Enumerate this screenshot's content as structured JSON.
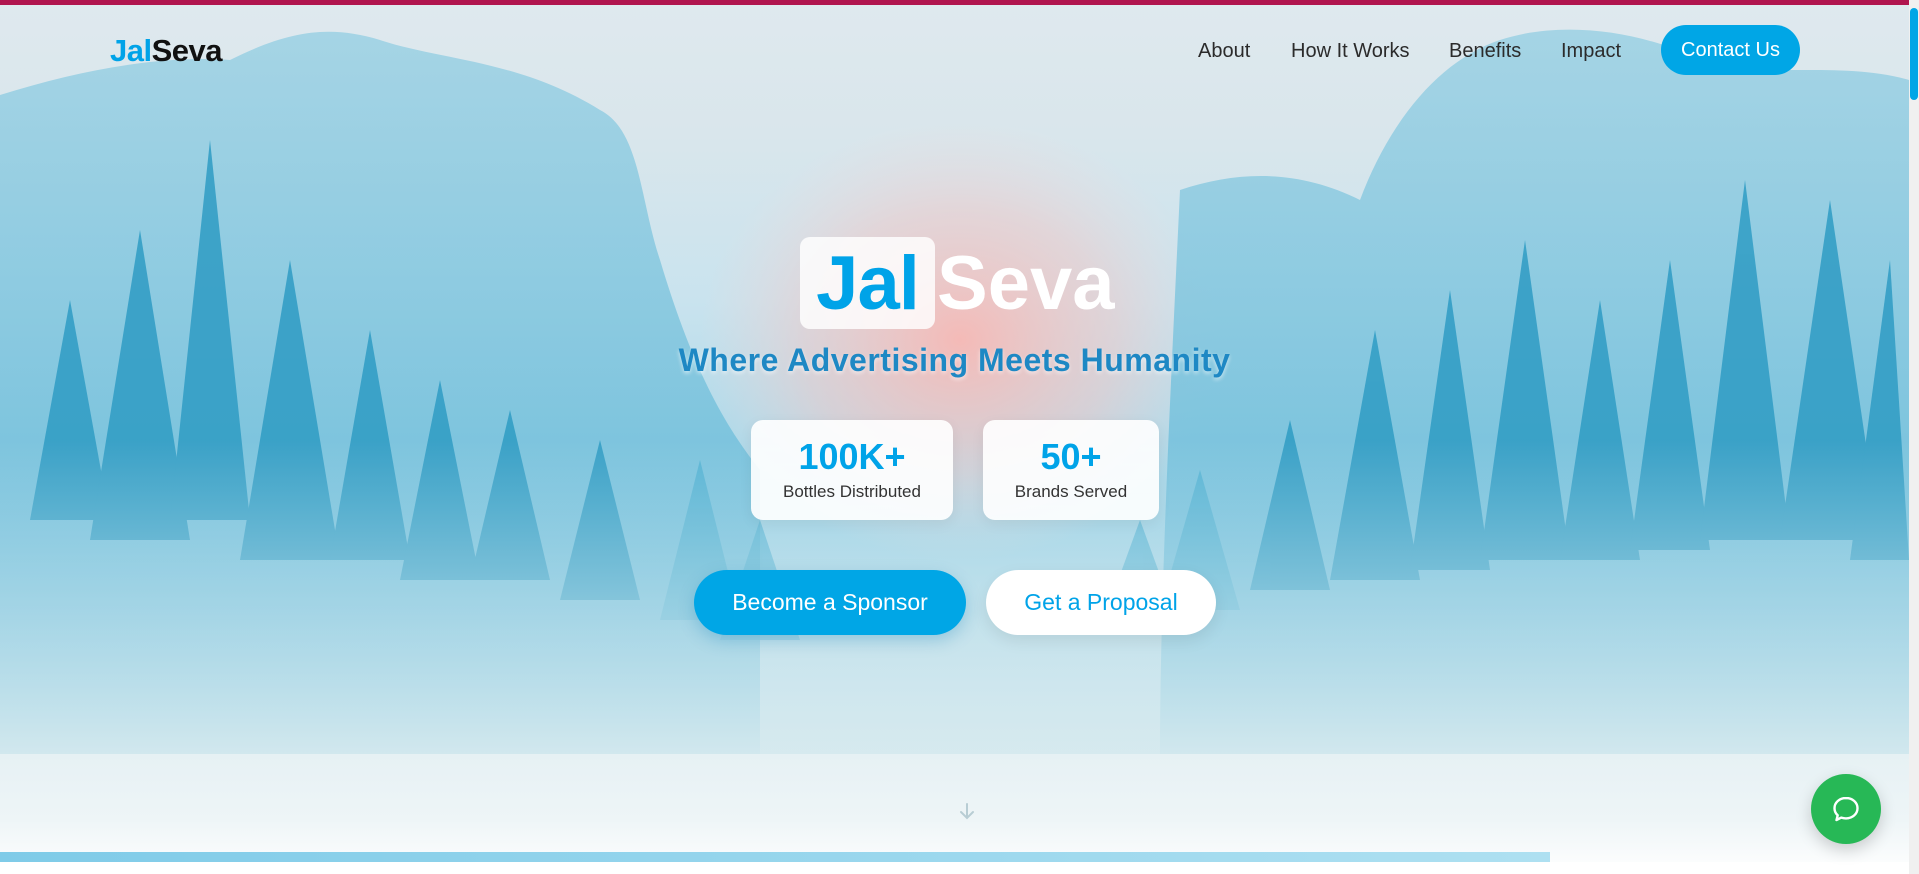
{
  "brand": {
    "logo_part1": "Jal",
    "logo_part2": "Seva"
  },
  "nav": {
    "links": [
      {
        "label": "About"
      },
      {
        "label": "How It Works"
      },
      {
        "label": "Benefits"
      },
      {
        "label": "Impact"
      }
    ],
    "cta": "Contact Us"
  },
  "hero": {
    "title_part1": "Jal",
    "title_part2": "Seva",
    "tagline": "Where Advertising Meets Humanity",
    "stats": [
      {
        "value": "100K+",
        "label": "Bottles Distributed"
      },
      {
        "value": "50+",
        "label": "Brands Served"
      }
    ],
    "primary_button": "Become a Sponsor",
    "secondary_button": "Get a Proposal"
  },
  "icons": {
    "chat": "chat-bubble-icon",
    "scroll": "arrow-down-icon"
  },
  "colors": {
    "accent": "#00a6e6",
    "top_strip": "#b0154e",
    "chat_fab": "#27b856",
    "logo_dark": "#111111"
  }
}
